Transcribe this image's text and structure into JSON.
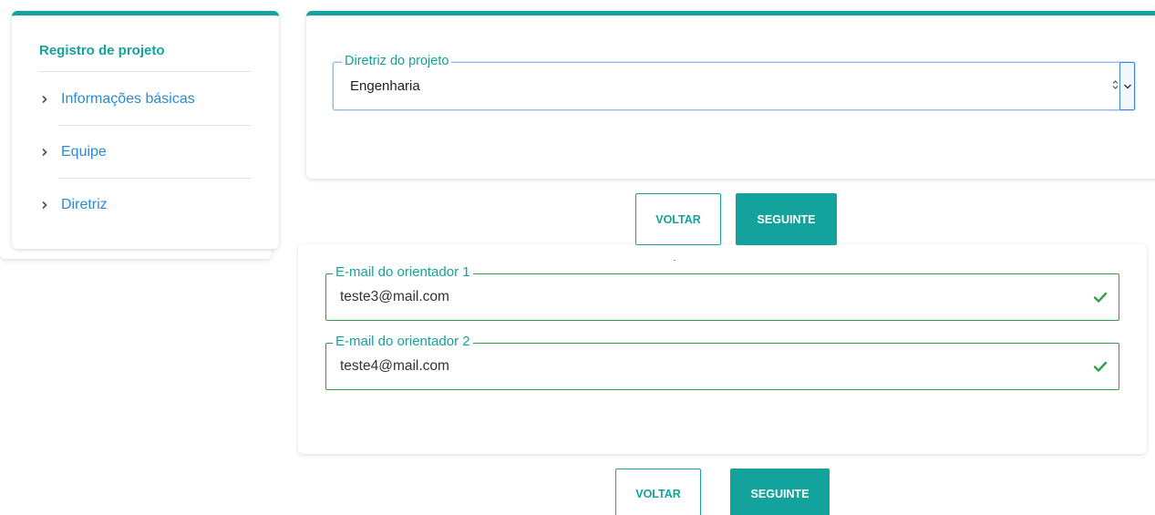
{
  "sidebar": {
    "title": "Registro de projeto",
    "items": [
      {
        "label": "Informações básicas"
      },
      {
        "label": "Equipe"
      },
      {
        "label": "Diretriz"
      }
    ]
  },
  "directive_step": {
    "select": {
      "legend": "Diretriz do projeto",
      "value": "Engenharia"
    },
    "back_label": "VOLTAR",
    "next_label": "SEGUINTE"
  },
  "team_step": {
    "advisor1": {
      "legend": "E-mail do orientador 1",
      "value": "teste3@mail.com"
    },
    "advisor2": {
      "legend": "E-mail do orientador 2",
      "value": "teste4@mail.com"
    },
    "back_label": "VOLTAR",
    "next_label": "SEGUINTE"
  },
  "colors": {
    "accent": "#14a39c",
    "link": "#2a8bd8",
    "valid": "#2fa04a",
    "focus": "#3a86e6"
  }
}
